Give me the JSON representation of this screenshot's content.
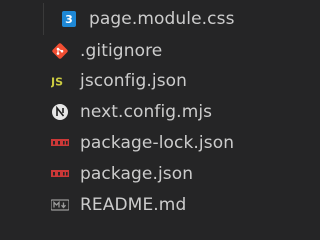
{
  "explorer": {
    "files": [
      {
        "name": "page.module.css",
        "icon": "css-file-icon"
      },
      {
        "name": ".gitignore",
        "icon": "git-file-icon"
      },
      {
        "name": "jsconfig.json",
        "icon": "json-js-file-icon"
      },
      {
        "name": "next.config.mjs",
        "icon": "nextjs-file-icon"
      },
      {
        "name": "package-lock.json",
        "icon": "npm-file-icon"
      },
      {
        "name": "package.json",
        "icon": "npm-file-icon"
      },
      {
        "name": "README.md",
        "icon": "markdown-file-icon"
      }
    ],
    "colors": {
      "background": "#252526",
      "text": "#cccccc",
      "css": "#1e88d6",
      "git": "#f14e32",
      "js": "#cbcb41",
      "npm": "#cb3837",
      "markdown": "#9a9a9a"
    }
  }
}
